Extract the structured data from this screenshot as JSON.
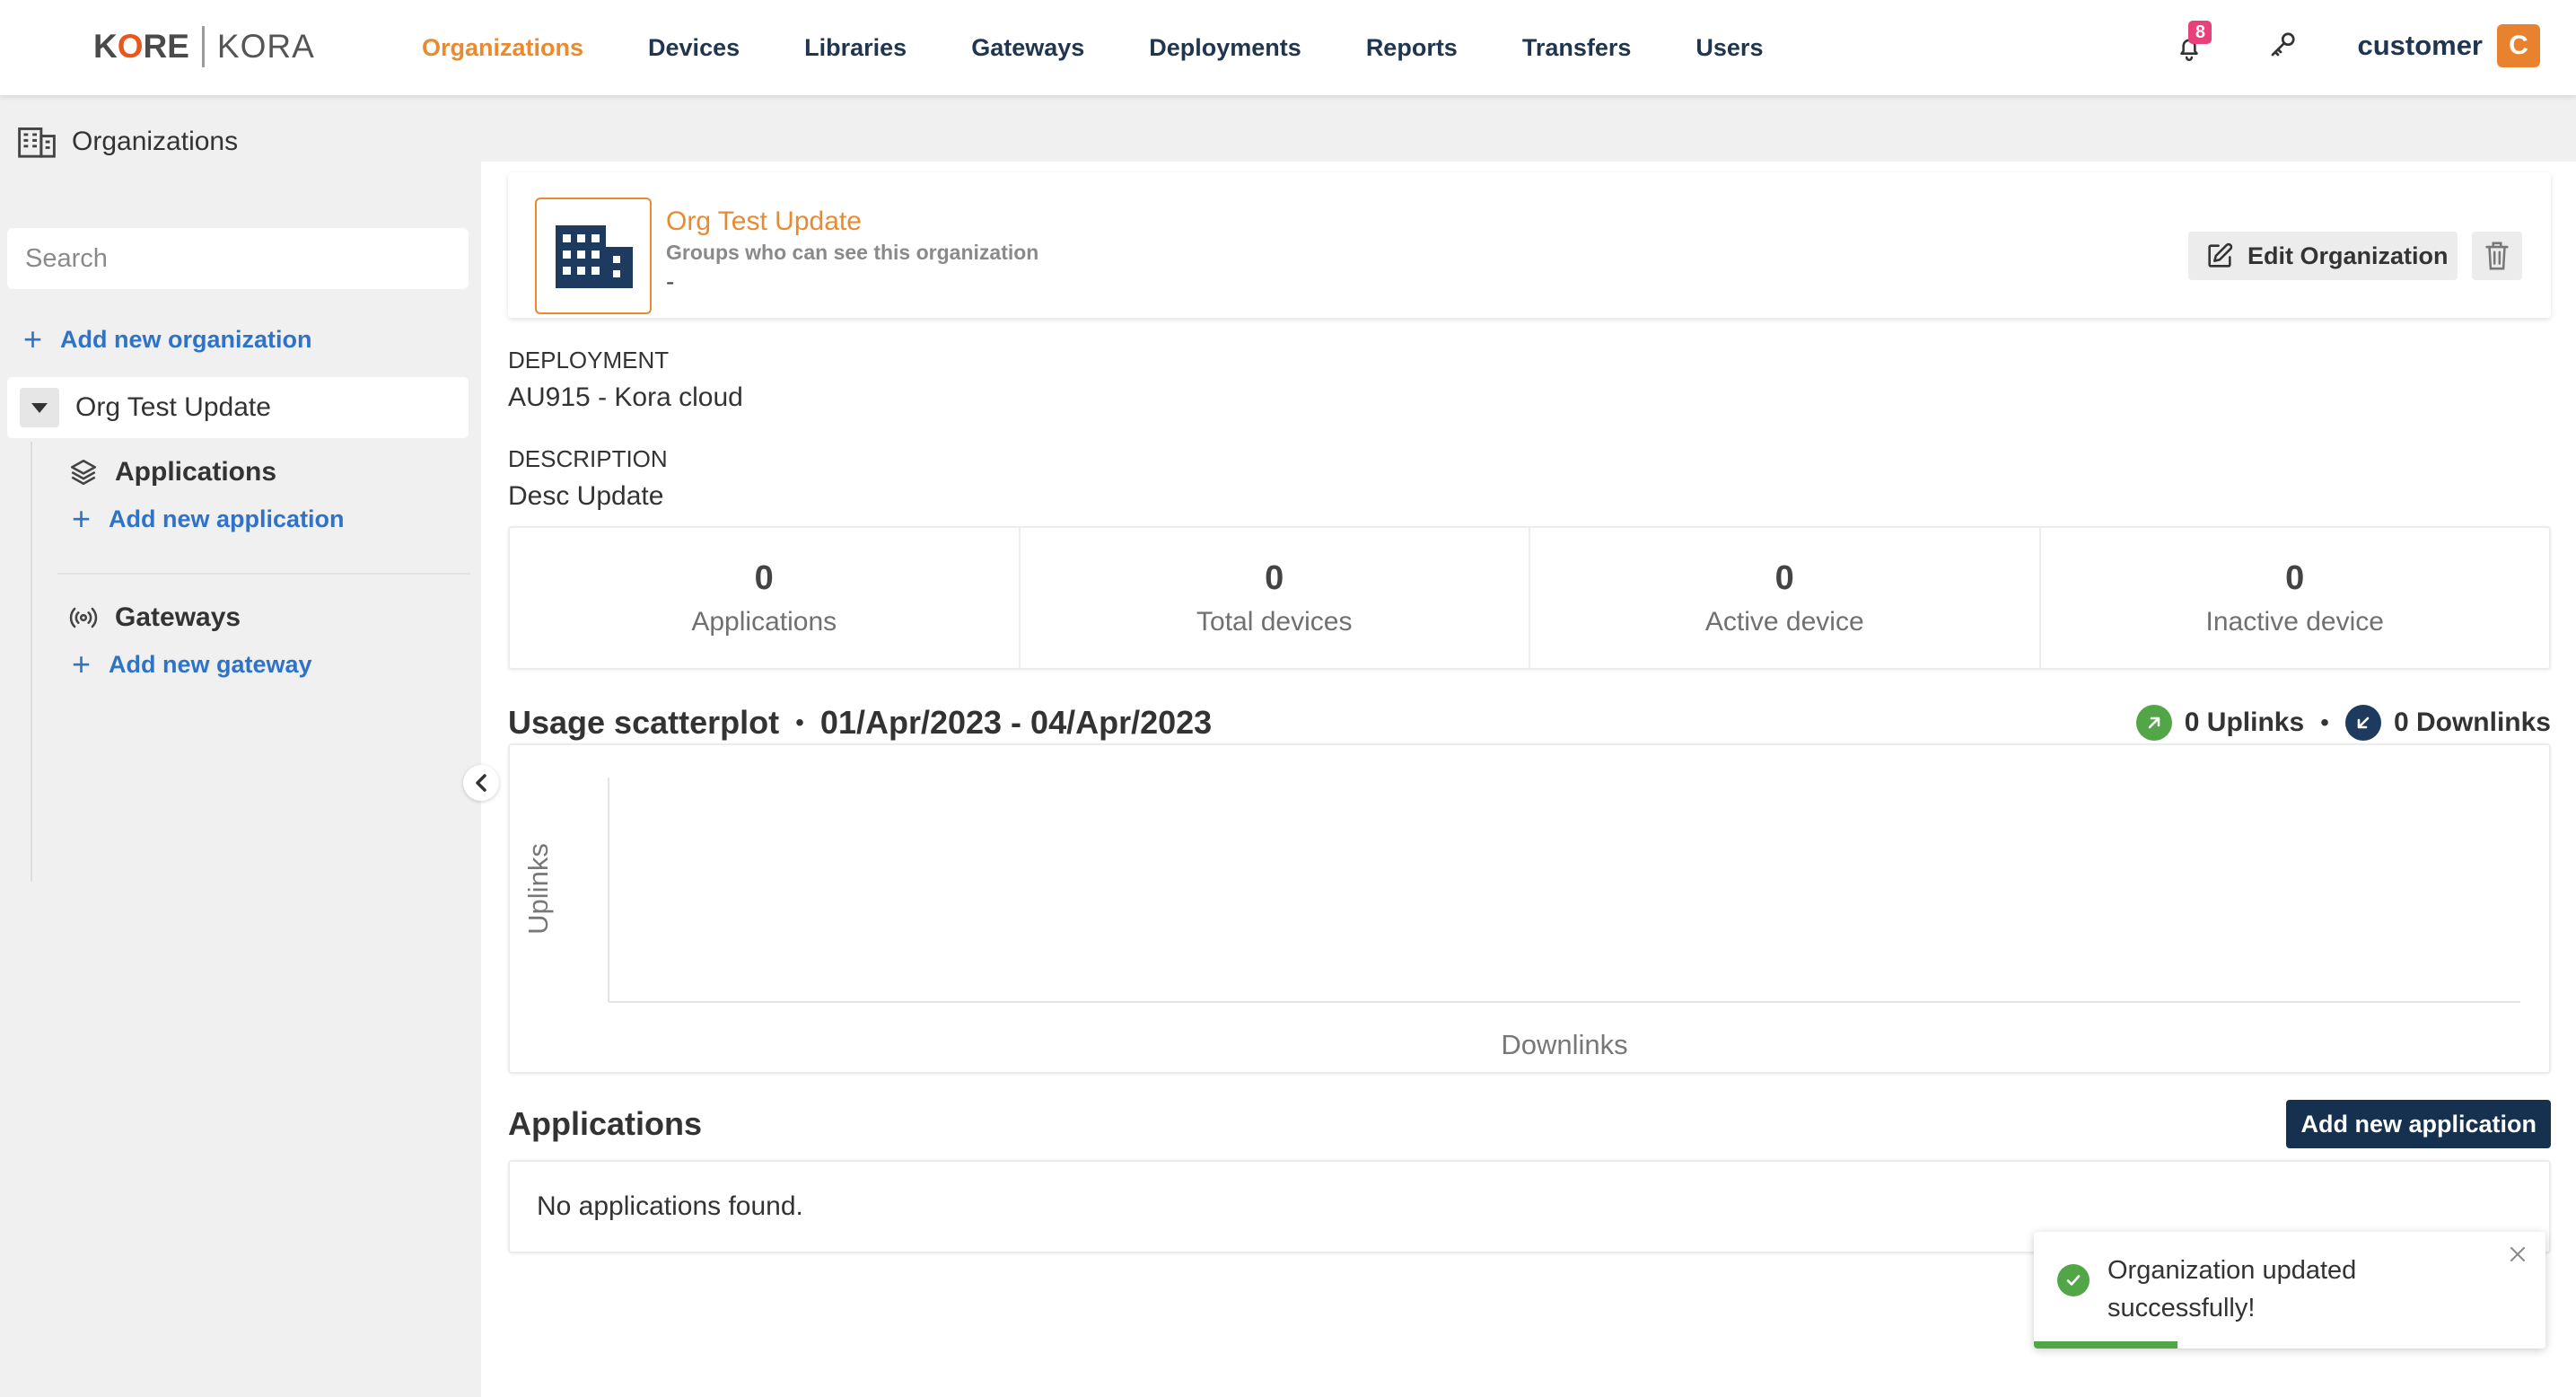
{
  "logo": {
    "kore_left": "K",
    "kore_o": "O",
    "kore_right": "RE",
    "kora": "KORA"
  },
  "nav": {
    "items": [
      {
        "label": "Organizations",
        "active": true
      },
      {
        "label": "Devices",
        "active": false
      },
      {
        "label": "Libraries",
        "active": false
      },
      {
        "label": "Gateways",
        "active": false
      },
      {
        "label": "Deployments",
        "active": false
      },
      {
        "label": "Reports",
        "active": false
      },
      {
        "label": "Transfers",
        "active": false
      },
      {
        "label": "Users",
        "active": false
      }
    ],
    "notifications_count": "8",
    "user_name": "customer",
    "avatar_initial": "C"
  },
  "sidebar": {
    "page_title": "Organizations",
    "search_placeholder": "Search",
    "add_org_label": "Add new organization",
    "org_name": "Org Test Update",
    "applications_label": "Applications",
    "add_application_label": "Add new application",
    "gateways_label": "Gateways",
    "add_gateway_label": "Add new gateway"
  },
  "org": {
    "name": "Org Test Update",
    "groups_label": "Groups who can see this organization",
    "groups_value": "-",
    "edit_label": "Edit Organization",
    "deployment_label": "DEPLOYMENT",
    "deployment_value": "AU915 - Kora cloud",
    "description_label": "DESCRIPTION",
    "description_value": "Desc Update"
  },
  "stats": [
    {
      "value": "0",
      "label": "Applications"
    },
    {
      "value": "0",
      "label": "Total devices"
    },
    {
      "value": "0",
      "label": "Active device"
    },
    {
      "value": "0",
      "label": "Inactive device"
    }
  ],
  "usage": {
    "title": "Usage scatterplot",
    "separator": "•",
    "range": "01/Apr/2023 - 04/Apr/2023",
    "uplinks_text": "0 Uplinks",
    "downlinks_text": "0 Downlinks"
  },
  "chart_data": {
    "type": "scatter",
    "title": "",
    "xlabel": "Downlinks",
    "ylabel": "Uplinks",
    "series": [],
    "points": []
  },
  "applications": {
    "title": "Applications",
    "add_label": "Add new application",
    "empty_text": "No applications found."
  },
  "toast": {
    "message": "Organization updated successfully!",
    "progress": 0.28
  },
  "colors": {
    "accent_orange": "#ea8a2e",
    "nav_blue": "#1f3550",
    "link_blue": "#2e73c8",
    "success_green": "#52a647",
    "badge_pink": "#e8407a",
    "dark_button": "#15314f"
  }
}
